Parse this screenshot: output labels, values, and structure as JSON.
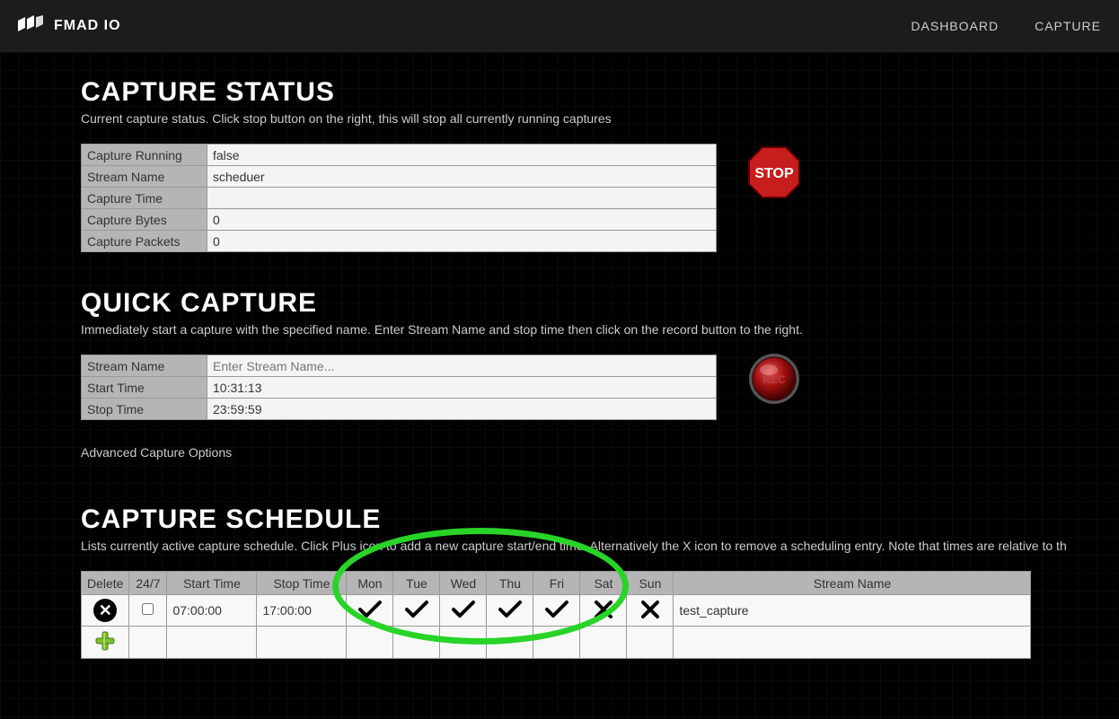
{
  "brand": "FMAD IO",
  "nav": {
    "dashboard": "DASHBOARD",
    "capture": "CAPTURE"
  },
  "status": {
    "title": "CAPTURE STATUS",
    "desc": "Current capture status. Click stop button on the right, this will stop all currently running captures",
    "running_label": "Capture Running",
    "running_val": "false",
    "stream_label": "Stream Name",
    "stream_val": "scheduer",
    "time_label": "Capture Time",
    "time_val": "",
    "bytes_label": "Capture Bytes",
    "bytes_val": "0",
    "packets_label": "Capture Packets",
    "packets_val": "0",
    "stop_label": "STOP"
  },
  "quick": {
    "title": "QUICK CAPTURE",
    "desc": "Immediately start a capture with the specified name. Enter Stream Name and stop time then click on the record button to the right.",
    "stream_label": "Stream Name",
    "stream_placeholder": "Enter Stream Name...",
    "start_label": "Start Time",
    "start_val": "10:31:13",
    "stop_label": "Stop Time",
    "stop_val": "23:59:59",
    "advanced": "Advanced Capture Options",
    "rec_label": "REC"
  },
  "schedule": {
    "title": "CAPTURE SCHEDULE",
    "desc": "Lists currently active capture schedule. Click Plus icon to add a new capture start/end time. Alternatively the X icon to remove a scheduling entry. Note that times are relative to th",
    "hdr": {
      "del": "Delete",
      "always": "24/7",
      "start": "Start Time",
      "stop": "Stop Time",
      "mon": "Mon",
      "tue": "Tue",
      "wed": "Wed",
      "thu": "Thu",
      "fri": "Fri",
      "sat": "Sat",
      "sun": "Sun",
      "name": "Stream Name"
    },
    "row": {
      "always": false,
      "start": "07:00:00",
      "stop": "17:00:00",
      "days": {
        "mon": true,
        "tue": true,
        "wed": true,
        "thu": true,
        "fri": true,
        "sat": false,
        "sun": false
      },
      "name": "test_capture"
    }
  }
}
